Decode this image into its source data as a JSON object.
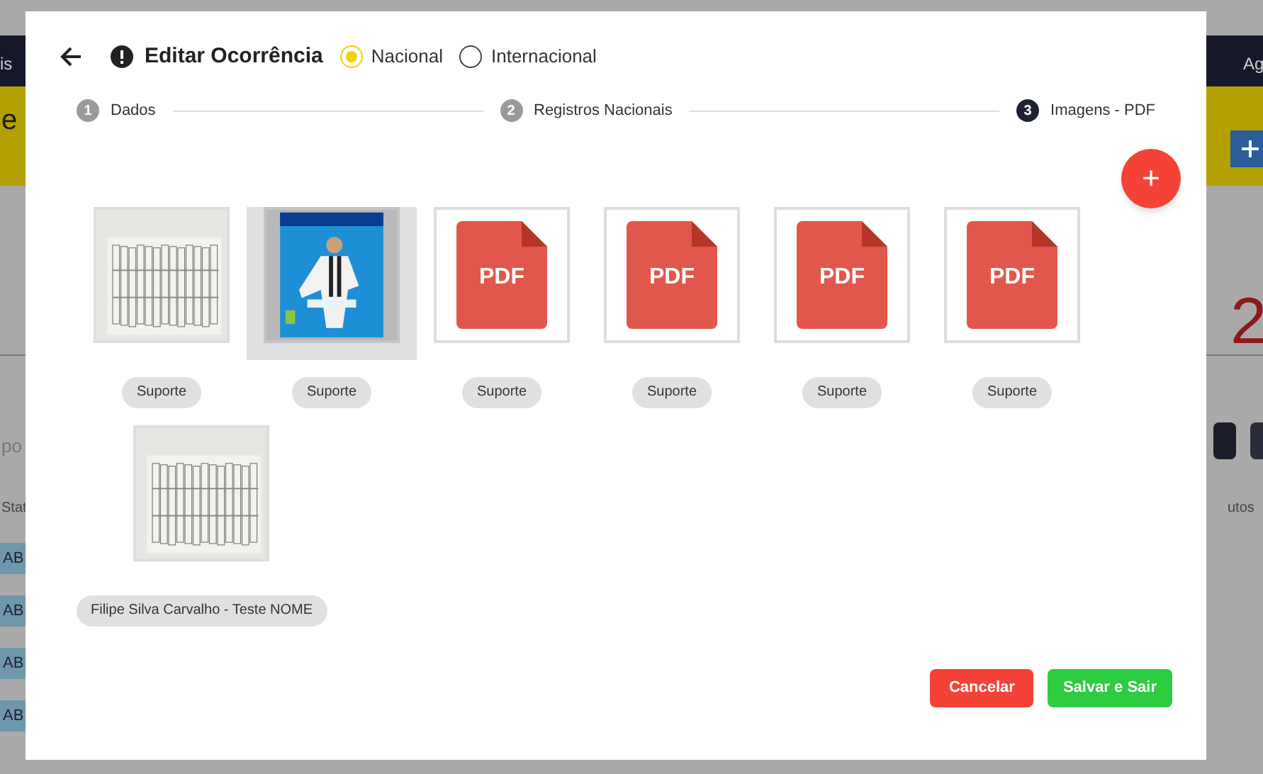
{
  "background": {
    "nav_left": "is",
    "nav_right": "Ag",
    "banner_left": "e",
    "counter": "2",
    "search_fragment": "po",
    "column_left": "Stat",
    "column_right": "utos",
    "status_badges": [
      "AB",
      "AB",
      "AB",
      "AB"
    ]
  },
  "dialog": {
    "title": "Editar Ocorrência",
    "scope_options": [
      {
        "label": "Nacional",
        "selected": true
      },
      {
        "label": "Internacional",
        "selected": false
      }
    ],
    "steps": [
      {
        "number": "1",
        "label": "Dados",
        "active": false
      },
      {
        "number": "2",
        "label": "Registros Nacionais",
        "active": false
      },
      {
        "number": "3",
        "label": "Imagens - PDF",
        "active": true
      }
    ],
    "add_button": "+",
    "files": [
      {
        "kind": "picture",
        "caption": "Suporte",
        "selected": false
      },
      {
        "kind": "picture",
        "caption": "Suporte",
        "selected": true
      },
      {
        "kind": "pdf",
        "label": "PDF",
        "caption": "Suporte",
        "selected": false
      },
      {
        "kind": "pdf",
        "label": "PDF",
        "caption": "Suporte",
        "selected": false
      },
      {
        "kind": "pdf",
        "label": "PDF",
        "caption": "Suporte",
        "selected": false
      },
      {
        "kind": "pdf",
        "label": "PDF",
        "caption": "Suporte",
        "selected": false
      },
      {
        "kind": "picture",
        "caption": "Filipe Silva Carvalho - Teste NOME",
        "selected": false
      }
    ],
    "buttons": {
      "cancel": "Cancelar",
      "save": "Salvar e Sair"
    }
  }
}
